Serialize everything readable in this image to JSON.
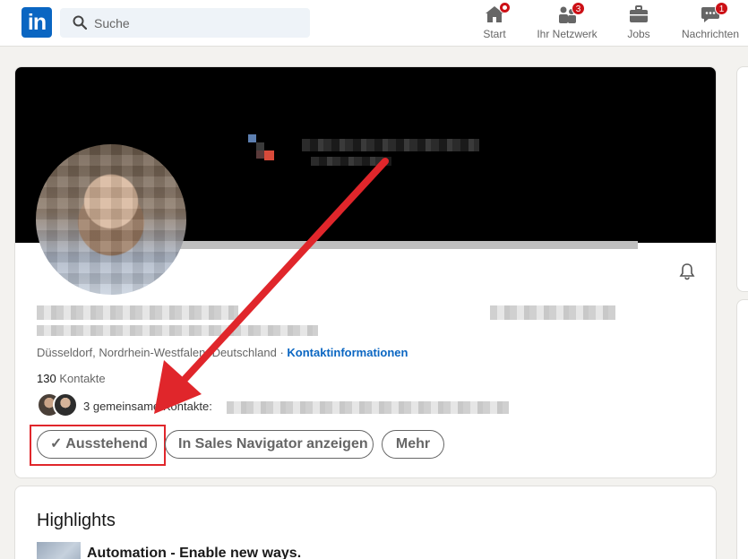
{
  "nav": {
    "logo_text": "in",
    "search_placeholder": "Suche",
    "items": [
      {
        "label": "Start",
        "icon": "home-icon",
        "badge": ""
      },
      {
        "label": "Ihr Netzwerk",
        "icon": "network-icon",
        "badge": "3"
      },
      {
        "label": "Jobs",
        "icon": "briefcase-icon",
        "badge": ""
      },
      {
        "label": "Nachrichten",
        "icon": "messaging-icon",
        "badge": "1"
      }
    ]
  },
  "profile": {
    "location": "Düsseldorf, Nordrhein-Westfalen, Deutschland",
    "separator": " · ",
    "contact_info": "Kontaktinformationen",
    "connections_count": "130",
    "connections_label": "Kontakte",
    "mutual_label": "3 gemeinsame Kontakte:",
    "buttons": {
      "pending": "Ausstehend",
      "pending_check": "✓",
      "sales_navigator": "In Sales Navigator anzeigen",
      "more": "Mehr"
    }
  },
  "highlights": {
    "title": "Highlights",
    "item_title": "Automation - Enable new ways."
  },
  "colors": {
    "brand": "#0a66c2",
    "annotation": "#e0262b",
    "badge": "#cc1016"
  }
}
